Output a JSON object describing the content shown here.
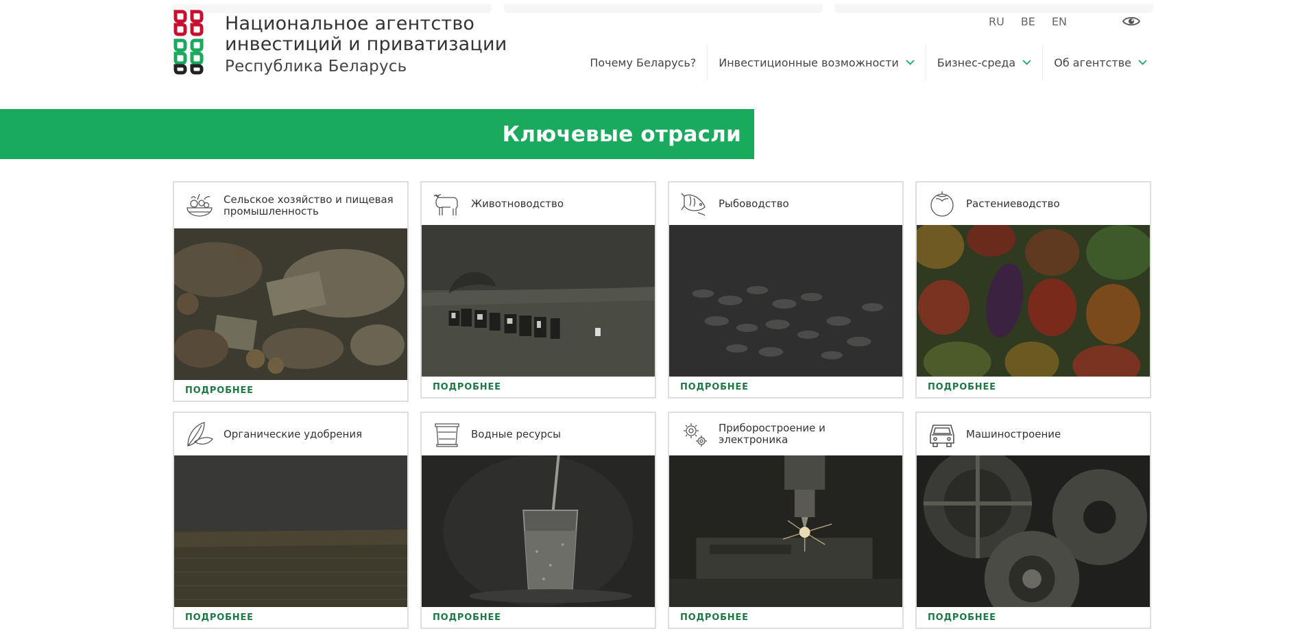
{
  "header": {
    "logo": {
      "line1": "Национальное агентство",
      "line2": "инвестиций и приватизации",
      "line3": "Республика Беларусь"
    },
    "languages": [
      "RU",
      "BE",
      "EN"
    ],
    "accessibility_icon": "eye-icon",
    "nav": [
      {
        "label": "Почему Беларусь?",
        "dropdown": false
      },
      {
        "label": "Инвестиционные возможности",
        "dropdown": true
      },
      {
        "label": "Бизнес-среда",
        "dropdown": true
      },
      {
        "label": "Об агентстве",
        "dropdown": true
      }
    ]
  },
  "banner": {
    "title": "Ключевые отрасли",
    "color": "#1aaa5e"
  },
  "accent_color": "#1d7a45",
  "cards": [
    {
      "title": "Сельское хозяйство и пищевая промышленность",
      "icon": "food-basket-icon",
      "more": "ПОДРОБНЕЕ"
    },
    {
      "title": "Животноводство",
      "icon": "cow-icon",
      "more": "ПОДРОБНЕЕ"
    },
    {
      "title": "Рыбоводство",
      "icon": "fish-icon",
      "more": "ПОДРОБНЕЕ"
    },
    {
      "title": "Растениеводство",
      "icon": "tomato-icon",
      "more": "ПОДРОБНЕЕ"
    },
    {
      "title": "Органические удобрения",
      "icon": "leaf-icon",
      "more": "ПОДРОБНЕЕ"
    },
    {
      "title": "Водные ресурсы",
      "icon": "water-bucket-icon",
      "more": "ПОДРОБНЕЕ"
    },
    {
      "title": "Приборостроение и электроника",
      "icon": "gears-icon",
      "more": "ПОДРОБНЕЕ"
    },
    {
      "title": "Машиностроение",
      "icon": "car-icon",
      "more": "ПОДРОБНЕЕ"
    }
  ]
}
